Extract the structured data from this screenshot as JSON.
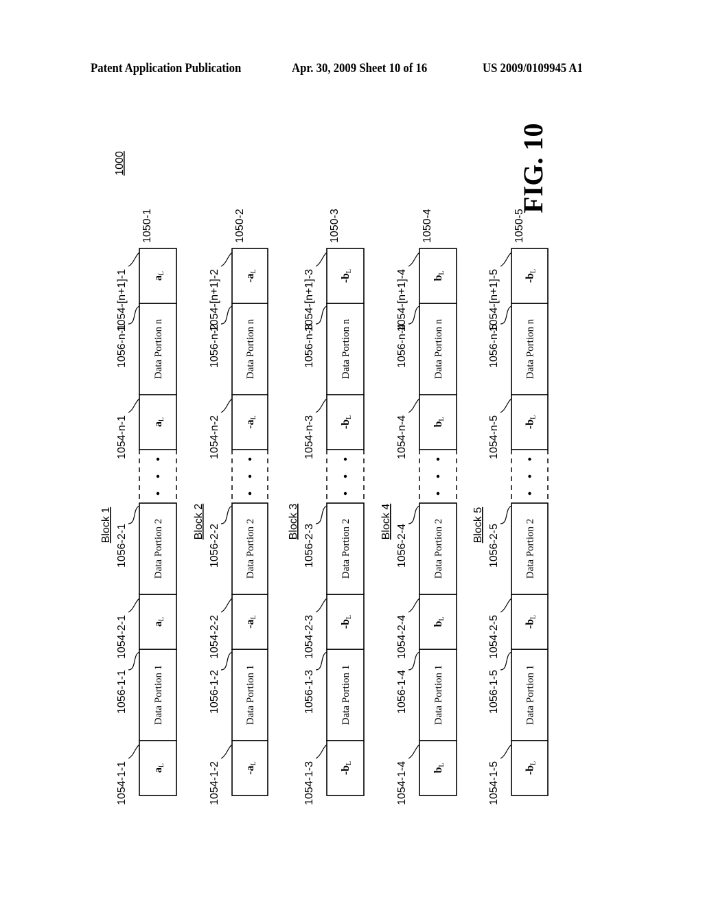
{
  "header": {
    "left": "Patent Application Publication",
    "middle": "Apr. 30, 2009  Sheet 10 of 16",
    "right": "US 2009/0109945 A1"
  },
  "figure": {
    "ref": "1000",
    "title": "FIG. 10"
  },
  "blocks": [
    {
      "name": "Block 1",
      "ref": "1050-1",
      "cells": [
        {
          "type": "sym",
          "text": "a",
          "sub": "L",
          "ref": "1054-1-1"
        },
        {
          "type": "data",
          "text": "Data Portion 1",
          "ref": "1056-1-1"
        },
        {
          "type": "sym",
          "text": "a",
          "sub": "L",
          "ref": "1054-2-1"
        },
        {
          "type": "data",
          "text": "Data Portion 2",
          "ref": "1056-2-1"
        },
        {
          "type": "ellipsis",
          "text": "• • •",
          "ref": ""
        },
        {
          "type": "sym",
          "text": "a",
          "sub": "L",
          "ref": "1054-n-1"
        },
        {
          "type": "data",
          "text": "Data Portion n",
          "ref": "1056-n-1"
        },
        {
          "type": "sym",
          "text": "a",
          "sub": "L",
          "ref": "1054-[n+1]-1"
        }
      ]
    },
    {
      "name": "Block 2",
      "ref": "1050-2",
      "cells": [
        {
          "type": "sym",
          "text": "-a",
          "sub": "L",
          "ref": "1054-1-2"
        },
        {
          "type": "data",
          "text": "Data Portion 1",
          "ref": "1056-1-2"
        },
        {
          "type": "sym",
          "text": "-a",
          "sub": "L",
          "ref": "1054-2-2"
        },
        {
          "type": "data",
          "text": "Data Portion 2",
          "ref": "1056-2-2"
        },
        {
          "type": "ellipsis",
          "text": "• • •",
          "ref": ""
        },
        {
          "type": "sym",
          "text": "-a",
          "sub": "L",
          "ref": "1054-n-2"
        },
        {
          "type": "data",
          "text": "Data Portion n",
          "ref": "1056-n-2"
        },
        {
          "type": "sym",
          "text": "-a",
          "sub": "L",
          "ref": "1054-[n+1]-2"
        }
      ]
    },
    {
      "name": "Block 3",
      "ref": "1050-3",
      "cells": [
        {
          "type": "sym",
          "text": "-b",
          "sub": "L",
          "ref": "1054-1-3"
        },
        {
          "type": "data",
          "text": "Data Portion 1",
          "ref": "1056-1-3"
        },
        {
          "type": "sym",
          "text": "-b",
          "sub": "L",
          "ref": "1054-2-3"
        },
        {
          "type": "data",
          "text": "Data Portion 2",
          "ref": "1056-2-3"
        },
        {
          "type": "ellipsis",
          "text": "• • •",
          "ref": ""
        },
        {
          "type": "sym",
          "text": "-b",
          "sub": "L",
          "ref": "1054-n-3"
        },
        {
          "type": "data",
          "text": "Data Portion n",
          "ref": "1056-n-3"
        },
        {
          "type": "sym",
          "text": "-b",
          "sub": "L",
          "ref": "1054-[n+1]-3"
        }
      ]
    },
    {
      "name": "Block 4",
      "ref": "1050-4",
      "cells": [
        {
          "type": "sym",
          "text": "b",
          "sub": "L",
          "ref": "1054-1-4"
        },
        {
          "type": "data",
          "text": "Data Portion 1",
          "ref": "1056-1-4"
        },
        {
          "type": "sym",
          "text": "b",
          "sub": "L",
          "ref": "1054-2-4"
        },
        {
          "type": "data",
          "text": "Data Portion 2",
          "ref": "1056-2-4"
        },
        {
          "type": "ellipsis",
          "text": "• • •",
          "ref": ""
        },
        {
          "type": "sym",
          "text": "b",
          "sub": "L",
          "ref": "1054-n-4"
        },
        {
          "type": "data",
          "text": "Data Portion n",
          "ref": "1056-n-4"
        },
        {
          "type": "sym",
          "text": "b",
          "sub": "L",
          "ref": "1054-[n+1]-4"
        }
      ]
    },
    {
      "name": "Block 5",
      "ref": "1050-5",
      "cells": [
        {
          "type": "sym",
          "text": "-b",
          "sub": "L",
          "ref": "1054-1-5"
        },
        {
          "type": "data",
          "text": "Data Portion 1",
          "ref": "1056-1-5"
        },
        {
          "type": "sym",
          "text": "-b",
          "sub": "L",
          "ref": "1054-2-5"
        },
        {
          "type": "data",
          "text": "Data Portion 2",
          "ref": "1056-2-5"
        },
        {
          "type": "ellipsis",
          "text": "• • •",
          "ref": ""
        },
        {
          "type": "sym",
          "text": "-b",
          "sub": "L",
          "ref": "1054-n-5"
        },
        {
          "type": "data",
          "text": "Data Portion n",
          "ref": "1056-n-5"
        },
        {
          "type": "sym",
          "text": "-b",
          "sub": "L",
          "ref": "1054-[n+1]-5"
        }
      ]
    }
  ]
}
